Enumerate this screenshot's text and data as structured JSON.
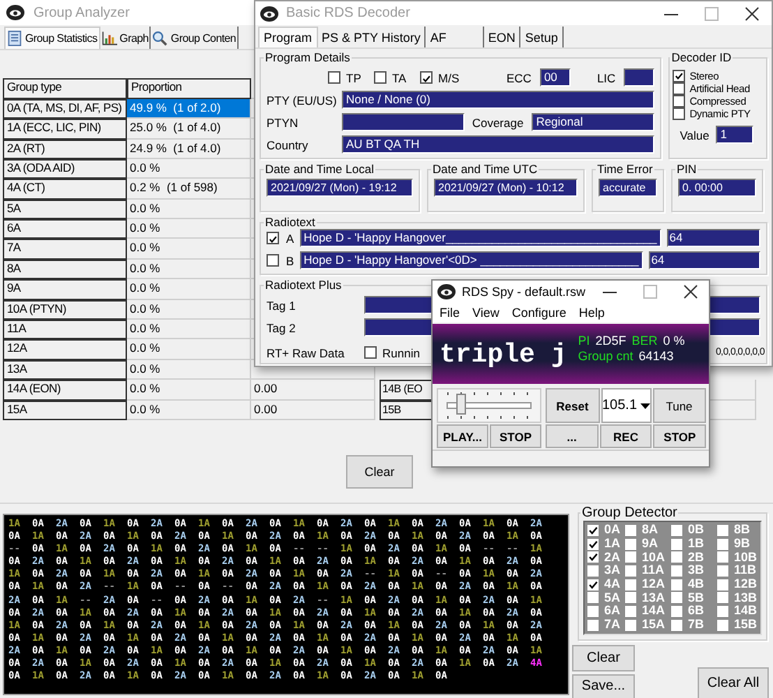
{
  "analyzer": {
    "title": "Group Analyzer",
    "tabs": [
      {
        "label": "Group Statistics",
        "selected": true
      },
      {
        "label": "Graph",
        "selected": false
      },
      {
        "label": "Group Conten",
        "selected": false
      }
    ],
    "table": {
      "columns": [
        "Group type",
        "Proportion"
      ],
      "rows": [
        {
          "group_type": "0A (TA, MS, DI, AF, PS)",
          "proportion": "49.9 %  (1 of 2.0)",
          "selected": true
        },
        {
          "group_type": "1A (ECC, LIC, PIN)",
          "proportion": "25.0 %  (1 of 4.0)",
          "selected": false
        },
        {
          "group_type": "2A (RT)",
          "proportion": "24.9 %  (1 of 4.0)",
          "selected": false
        },
        {
          "group_type": "3A (ODA AID)",
          "proportion": "0.0 %",
          "selected": false
        },
        {
          "group_type": "4A (CT)",
          "proportion": "0.2 %  (1 of 598)",
          "selected": false
        },
        {
          "group_type": "5A",
          "proportion": "0.0 %",
          "selected": false
        },
        {
          "group_type": "6A",
          "proportion": "0.0 %",
          "selected": false
        },
        {
          "group_type": "7A",
          "proportion": "0.0 %",
          "selected": false
        },
        {
          "group_type": "8A",
          "proportion": "0.0 %",
          "selected": false
        },
        {
          "group_type": "9A",
          "proportion": "0.0 %",
          "selected": false
        },
        {
          "group_type": "10A (PTYN)",
          "proportion": "0.0 %",
          "selected": false
        },
        {
          "group_type": "11A",
          "proportion": "0.0 %",
          "selected": false
        },
        {
          "group_type": "12A",
          "proportion": "0.0 %",
          "selected": false
        },
        {
          "group_type": "13A",
          "proportion": "0.0 %",
          "selected": false
        },
        {
          "group_type": "14A (EON)",
          "proportion": "0.0 %",
          "column_3": "0.00",
          "selected": false
        },
        {
          "group_type": "15A",
          "proportion": "0.0 %",
          "column_3": "0.00",
          "selected": false
        }
      ]
    },
    "right_table": {
      "rows": [
        {
          "group_type": "14B (EO"
        },
        {
          "group_type": "15B"
        }
      ]
    },
    "clear_button": "Clear"
  },
  "log": {
    "rows": [
      [
        {
          "group": "1A",
          "color": "#a0a030"
        },
        {
          "group": "0A",
          "color": "#ffffff"
        },
        {
          "group": "2A",
          "color": "#a8cff0"
        },
        {
          "group": "0A",
          "color": "#ffffff"
        },
        {
          "group": "1A",
          "color": "#a0a030"
        },
        {
          "group": "0A",
          "color": "#ffffff"
        },
        {
          "group": "2A",
          "color": "#a8cff0"
        },
        {
          "group": "0A",
          "color": "#ffffff"
        },
        {
          "group": "1A",
          "color": "#a0a030"
        },
        {
          "group": "0A",
          "color": "#ffffff"
        },
        {
          "group": "2A",
          "color": "#a8cff0"
        },
        {
          "group": "0A",
          "color": "#ffffff"
        },
        {
          "group": "1A",
          "color": "#a0a030"
        },
        {
          "group": "0A",
          "color": "#ffffff"
        },
        {
          "group": "2A",
          "color": "#a8cff0"
        },
        {
          "group": "0A",
          "color": "#ffffff"
        },
        {
          "group": "1A",
          "color": "#a0a030"
        },
        {
          "group": "0A",
          "color": "#ffffff"
        },
        {
          "group": "2A",
          "color": "#a8cff0"
        },
        {
          "group": "0A",
          "color": "#ffffff"
        },
        {
          "group": "1A",
          "color": "#a0a030"
        },
        {
          "group": "0A",
          "color": "#ffffff"
        },
        {
          "group": "2A",
          "color": "#a8cff0"
        }
      ],
      [
        {
          "group": "0A",
          "color": "#ffffff"
        },
        {
          "group": "1A",
          "color": "#a0a030"
        },
        {
          "group": "0A",
          "color": "#ffffff"
        },
        {
          "group": "2A",
          "color": "#a8cff0"
        },
        {
          "group": "0A",
          "color": "#ffffff"
        },
        {
          "group": "1A",
          "color": "#a0a030"
        },
        {
          "group": "0A",
          "color": "#ffffff"
        },
        {
          "group": "2A",
          "color": "#a8cff0"
        },
        {
          "group": "0A",
          "color": "#ffffff"
        },
        {
          "group": "1A",
          "color": "#a0a030"
        },
        {
          "group": "0A",
          "color": "#ffffff"
        },
        {
          "group": "2A",
          "color": "#a8cff0"
        },
        {
          "group": "0A",
          "color": "#ffffff"
        },
        {
          "group": "1A",
          "color": "#a0a030"
        },
        {
          "group": "0A",
          "color": "#ffffff"
        },
        {
          "group": "2A",
          "color": "#a8cff0"
        },
        {
          "group": "0A",
          "color": "#ffffff"
        },
        {
          "group": "1A",
          "color": "#a0a030"
        },
        {
          "group": "0A",
          "color": "#ffffff"
        },
        {
          "group": "2A",
          "color": "#a8cff0"
        },
        {
          "group": "0A",
          "color": "#ffffff"
        },
        {
          "group": "1A",
          "color": "#a0a030"
        },
        {
          "group": "0A",
          "color": "#ffffff"
        }
      ],
      [
        {
          "group": "--",
          "color": "#8c8c8c"
        },
        {
          "group": "0A",
          "color": "#ffffff"
        },
        {
          "group": "1A",
          "color": "#a0a030"
        },
        {
          "group": "0A",
          "color": "#ffffff"
        },
        {
          "group": "2A",
          "color": "#a8cff0"
        },
        {
          "group": "0A",
          "color": "#ffffff"
        },
        {
          "group": "1A",
          "color": "#a0a030"
        },
        {
          "group": "0A",
          "color": "#ffffff"
        },
        {
          "group": "2A",
          "color": "#a8cff0"
        },
        {
          "group": "0A",
          "color": "#ffffff"
        },
        {
          "group": "1A",
          "color": "#a0a030"
        },
        {
          "group": "0A",
          "color": "#ffffff"
        },
        {
          "group": "--",
          "color": "#8c8c8c"
        },
        {
          "group": "--",
          "color": "#8c8c8c"
        },
        {
          "group": "1A",
          "color": "#a0a030"
        },
        {
          "group": "0A",
          "color": "#ffffff"
        },
        {
          "group": "2A",
          "color": "#a8cff0"
        },
        {
          "group": "0A",
          "color": "#ffffff"
        },
        {
          "group": "1A",
          "color": "#a0a030"
        },
        {
          "group": "0A",
          "color": "#ffffff"
        },
        {
          "group": "--",
          "color": "#8c8c8c"
        },
        {
          "group": "--",
          "color": "#8c8c8c"
        },
        {
          "group": "1A",
          "color": "#a0a030"
        }
      ],
      [
        {
          "group": "0A",
          "color": "#ffffff"
        },
        {
          "group": "2A",
          "color": "#a8cff0"
        },
        {
          "group": "0A",
          "color": "#ffffff"
        },
        {
          "group": "1A",
          "color": "#a0a030"
        },
        {
          "group": "0A",
          "color": "#ffffff"
        },
        {
          "group": "2A",
          "color": "#a8cff0"
        },
        {
          "group": "0A",
          "color": "#ffffff"
        },
        {
          "group": "1A",
          "color": "#a0a030"
        },
        {
          "group": "0A",
          "color": "#ffffff"
        },
        {
          "group": "2A",
          "color": "#a8cff0"
        },
        {
          "group": "0A",
          "color": "#ffffff"
        },
        {
          "group": "1A",
          "color": "#a0a030"
        },
        {
          "group": "0A",
          "color": "#ffffff"
        },
        {
          "group": "2A",
          "color": "#a8cff0"
        },
        {
          "group": "0A",
          "color": "#ffffff"
        },
        {
          "group": "1A",
          "color": "#a0a030"
        },
        {
          "group": "0A",
          "color": "#ffffff"
        },
        {
          "group": "2A",
          "color": "#a8cff0"
        },
        {
          "group": "0A",
          "color": "#ffffff"
        },
        {
          "group": "1A",
          "color": "#a0a030"
        },
        {
          "group": "0A",
          "color": "#ffffff"
        },
        {
          "group": "2A",
          "color": "#a8cff0"
        },
        {
          "group": "0A",
          "color": "#ffffff"
        }
      ],
      [
        {
          "group": "1A",
          "color": "#a0a030"
        },
        {
          "group": "0A",
          "color": "#ffffff"
        },
        {
          "group": "2A",
          "color": "#a8cff0"
        },
        {
          "group": "0A",
          "color": "#ffffff"
        },
        {
          "group": "1A",
          "color": "#a0a030"
        },
        {
          "group": "0A",
          "color": "#ffffff"
        },
        {
          "group": "2A",
          "color": "#a8cff0"
        },
        {
          "group": "0A",
          "color": "#ffffff"
        },
        {
          "group": "1A",
          "color": "#a0a030"
        },
        {
          "group": "0A",
          "color": "#ffffff"
        },
        {
          "group": "2A",
          "color": "#a8cff0"
        },
        {
          "group": "0A",
          "color": "#ffffff"
        },
        {
          "group": "1A",
          "color": "#a0a030"
        },
        {
          "group": "0A",
          "color": "#ffffff"
        },
        {
          "group": "2A",
          "color": "#a8cff0"
        },
        {
          "group": "--",
          "color": "#8c8c8c"
        },
        {
          "group": "1A",
          "color": "#a0a030"
        },
        {
          "group": "0A",
          "color": "#ffffff"
        },
        {
          "group": "--",
          "color": "#8c8c8c"
        },
        {
          "group": "0A",
          "color": "#ffffff"
        },
        {
          "group": "1A",
          "color": "#a0a030"
        },
        {
          "group": "0A",
          "color": "#ffffff"
        },
        {
          "group": "2A",
          "color": "#a8cff0"
        }
      ],
      [
        {
          "group": "0A",
          "color": "#ffffff"
        },
        {
          "group": "1A",
          "color": "#a0a030"
        },
        {
          "group": "0A",
          "color": "#ffffff"
        },
        {
          "group": "2A",
          "color": "#a8cff0"
        },
        {
          "group": "--",
          "color": "#8c8c8c"
        },
        {
          "group": "1A",
          "color": "#a0a030"
        },
        {
          "group": "0A",
          "color": "#ffffff"
        },
        {
          "group": "--",
          "color": "#8c8c8c"
        },
        {
          "group": "0A",
          "color": "#ffffff"
        },
        {
          "group": "--",
          "color": "#8c8c8c"
        },
        {
          "group": "0A",
          "color": "#ffffff"
        },
        {
          "group": "2A",
          "color": "#a8cff0"
        },
        {
          "group": "0A",
          "color": "#ffffff"
        },
        {
          "group": "1A",
          "color": "#a0a030"
        },
        {
          "group": "0A",
          "color": "#ffffff"
        },
        {
          "group": "2A",
          "color": "#a8cff0"
        },
        {
          "group": "0A",
          "color": "#ffffff"
        },
        {
          "group": "1A",
          "color": "#a0a030"
        },
        {
          "group": "0A",
          "color": "#ffffff"
        },
        {
          "group": "2A",
          "color": "#a8cff0"
        },
        {
          "group": "0A",
          "color": "#ffffff"
        },
        {
          "group": "1A",
          "color": "#a0a030"
        },
        {
          "group": "0A",
          "color": "#ffffff"
        }
      ],
      [
        {
          "group": "2A",
          "color": "#a8cff0"
        },
        {
          "group": "0A",
          "color": "#ffffff"
        },
        {
          "group": "1A",
          "color": "#a0a030"
        },
        {
          "group": "--",
          "color": "#8c8c8c"
        },
        {
          "group": "2A",
          "color": "#a8cff0"
        },
        {
          "group": "0A",
          "color": "#ffffff"
        },
        {
          "group": "--",
          "color": "#8c8c8c"
        },
        {
          "group": "0A",
          "color": "#ffffff"
        },
        {
          "group": "2A",
          "color": "#a8cff0"
        },
        {
          "group": "0A",
          "color": "#ffffff"
        },
        {
          "group": "1A",
          "color": "#a0a030"
        },
        {
          "group": "0A",
          "color": "#ffffff"
        },
        {
          "group": "2A",
          "color": "#a8cff0"
        },
        {
          "group": "--",
          "color": "#8c8c8c"
        },
        {
          "group": "1A",
          "color": "#a0a030"
        },
        {
          "group": "0A",
          "color": "#ffffff"
        },
        {
          "group": "2A",
          "color": "#a8cff0"
        },
        {
          "group": "0A",
          "color": "#ffffff"
        },
        {
          "group": "1A",
          "color": "#a0a030"
        },
        {
          "group": "0A",
          "color": "#ffffff"
        },
        {
          "group": "2A",
          "color": "#a8cff0"
        },
        {
          "group": "0A",
          "color": "#ffffff"
        },
        {
          "group": "1A",
          "color": "#a0a030"
        }
      ],
      [
        {
          "group": "0A",
          "color": "#ffffff"
        },
        {
          "group": "2A",
          "color": "#a8cff0"
        },
        {
          "group": "0A",
          "color": "#ffffff"
        },
        {
          "group": "1A",
          "color": "#a0a030"
        },
        {
          "group": "0A",
          "color": "#ffffff"
        },
        {
          "group": "2A",
          "color": "#a8cff0"
        },
        {
          "group": "0A",
          "color": "#ffffff"
        },
        {
          "group": "1A",
          "color": "#a0a030"
        },
        {
          "group": "0A",
          "color": "#ffffff"
        },
        {
          "group": "2A",
          "color": "#a8cff0"
        },
        {
          "group": "0A",
          "color": "#ffffff"
        },
        {
          "group": "1A",
          "color": "#a0a030"
        },
        {
          "group": "0A",
          "color": "#ffffff"
        },
        {
          "group": "2A",
          "color": "#a8cff0"
        },
        {
          "group": "0A",
          "color": "#ffffff"
        },
        {
          "group": "1A",
          "color": "#a0a030"
        },
        {
          "group": "0A",
          "color": "#ffffff"
        },
        {
          "group": "2A",
          "color": "#a8cff0"
        },
        {
          "group": "0A",
          "color": "#ffffff"
        },
        {
          "group": "1A",
          "color": "#a0a030"
        },
        {
          "group": "0A",
          "color": "#ffffff"
        },
        {
          "group": "2A",
          "color": "#a8cff0"
        },
        {
          "group": "0A",
          "color": "#ffffff"
        }
      ],
      [
        {
          "group": "1A",
          "color": "#a0a030"
        },
        {
          "group": "0A",
          "color": "#ffffff"
        },
        {
          "group": "2A",
          "color": "#a8cff0"
        },
        {
          "group": "0A",
          "color": "#ffffff"
        },
        {
          "group": "1A",
          "color": "#a0a030"
        },
        {
          "group": "0A",
          "color": "#ffffff"
        },
        {
          "group": "2A",
          "color": "#a8cff0"
        },
        {
          "group": "0A",
          "color": "#ffffff"
        },
        {
          "group": "1A",
          "color": "#a0a030"
        },
        {
          "group": "0A",
          "color": "#ffffff"
        },
        {
          "group": "2A",
          "color": "#a8cff0"
        },
        {
          "group": "0A",
          "color": "#ffffff"
        },
        {
          "group": "1A",
          "color": "#a0a030"
        },
        {
          "group": "0A",
          "color": "#ffffff"
        },
        {
          "group": "2A",
          "color": "#a8cff0"
        },
        {
          "group": "0A",
          "color": "#ffffff"
        },
        {
          "group": "1A",
          "color": "#a0a030"
        },
        {
          "group": "0A",
          "color": "#ffffff"
        },
        {
          "group": "2A",
          "color": "#a8cff0"
        },
        {
          "group": "0A",
          "color": "#ffffff"
        },
        {
          "group": "1A",
          "color": "#a0a030"
        },
        {
          "group": "0A",
          "color": "#ffffff"
        },
        {
          "group": "2A",
          "color": "#a8cff0"
        }
      ],
      [
        {
          "group": "0A",
          "color": "#ffffff"
        },
        {
          "group": "1A",
          "color": "#a0a030"
        },
        {
          "group": "0A",
          "color": "#ffffff"
        },
        {
          "group": "2A",
          "color": "#a8cff0"
        },
        {
          "group": "0A",
          "color": "#ffffff"
        },
        {
          "group": "1A",
          "color": "#a0a030"
        },
        {
          "group": "0A",
          "color": "#ffffff"
        },
        {
          "group": "2A",
          "color": "#a8cff0"
        },
        {
          "group": "0A",
          "color": "#ffffff"
        },
        {
          "group": "1A",
          "color": "#a0a030"
        },
        {
          "group": "0A",
          "color": "#ffffff"
        },
        {
          "group": "2A",
          "color": "#a8cff0"
        },
        {
          "group": "0A",
          "color": "#ffffff"
        },
        {
          "group": "1A",
          "color": "#a0a030"
        },
        {
          "group": "0A",
          "color": "#ffffff"
        },
        {
          "group": "2A",
          "color": "#a8cff0"
        },
        {
          "group": "0A",
          "color": "#ffffff"
        },
        {
          "group": "1A",
          "color": "#a0a030"
        },
        {
          "group": "0A",
          "color": "#ffffff"
        },
        {
          "group": "2A",
          "color": "#a8cff0"
        },
        {
          "group": "0A",
          "color": "#ffffff"
        },
        {
          "group": "1A",
          "color": "#a0a030"
        },
        {
          "group": "0A",
          "color": "#ffffff"
        }
      ],
      [
        {
          "group": "2A",
          "color": "#a8cff0"
        },
        {
          "group": "0A",
          "color": "#ffffff"
        },
        {
          "group": "1A",
          "color": "#a0a030"
        },
        {
          "group": "0A",
          "color": "#ffffff"
        },
        {
          "group": "2A",
          "color": "#a8cff0"
        },
        {
          "group": "0A",
          "color": "#ffffff"
        },
        {
          "group": "1A",
          "color": "#a0a030"
        },
        {
          "group": "0A",
          "color": "#ffffff"
        },
        {
          "group": "2A",
          "color": "#a8cff0"
        },
        {
          "group": "0A",
          "color": "#ffffff"
        },
        {
          "group": "1A",
          "color": "#a0a030"
        },
        {
          "group": "0A",
          "color": "#ffffff"
        },
        {
          "group": "2A",
          "color": "#a8cff0"
        },
        {
          "group": "0A",
          "color": "#ffffff"
        },
        {
          "group": "1A",
          "color": "#a0a030"
        },
        {
          "group": "0A",
          "color": "#ffffff"
        },
        {
          "group": "2A",
          "color": "#a8cff0"
        },
        {
          "group": "0A",
          "color": "#ffffff"
        },
        {
          "group": "1A",
          "color": "#a0a030"
        },
        {
          "group": "0A",
          "color": "#ffffff"
        },
        {
          "group": "2A",
          "color": "#a8cff0"
        },
        {
          "group": "0A",
          "color": "#ffffff"
        },
        {
          "group": "1A",
          "color": "#a0a030"
        }
      ],
      [
        {
          "group": "0A",
          "color": "#ffffff"
        },
        {
          "group": "2A",
          "color": "#a8cff0"
        },
        {
          "group": "0A",
          "color": "#ffffff"
        },
        {
          "group": "1A",
          "color": "#a0a030"
        },
        {
          "group": "0A",
          "color": "#ffffff"
        },
        {
          "group": "2A",
          "color": "#a8cff0"
        },
        {
          "group": "0A",
          "color": "#ffffff"
        },
        {
          "group": "1A",
          "color": "#a0a030"
        },
        {
          "group": "0A",
          "color": "#ffffff"
        },
        {
          "group": "2A",
          "color": "#a8cff0"
        },
        {
          "group": "0A",
          "color": "#ffffff"
        },
        {
          "group": "1A",
          "color": "#a0a030"
        },
        {
          "group": "0A",
          "color": "#ffffff"
        },
        {
          "group": "2A",
          "color": "#a8cff0"
        },
        {
          "group": "0A",
          "color": "#ffffff"
        },
        {
          "group": "1A",
          "color": "#a0a030"
        },
        {
          "group": "0A",
          "color": "#ffffff"
        },
        {
          "group": "2A",
          "color": "#a8cff0"
        },
        {
          "group": "0A",
          "color": "#ffffff"
        },
        {
          "group": "1A",
          "color": "#a0a030"
        },
        {
          "group": "0A",
          "color": "#ffffff"
        },
        {
          "group": "2A",
          "color": "#a8cff0"
        },
        {
          "group": "4A",
          "color": "#ff30ff"
        }
      ],
      [
        {
          "group": "0A",
          "color": "#ffffff"
        },
        {
          "group": "1A",
          "color": "#a0a030"
        },
        {
          "group": "0A",
          "color": "#ffffff"
        },
        {
          "group": "2A",
          "color": "#a8cff0"
        },
        {
          "group": "0A",
          "color": "#ffffff"
        },
        {
          "group": "1A",
          "color": "#a0a030"
        },
        {
          "group": "0A",
          "color": "#ffffff"
        },
        {
          "group": "2A",
          "color": "#a8cff0"
        },
        {
          "group": "0A",
          "color": "#ffffff"
        },
        {
          "group": "1A",
          "color": "#a0a030"
        },
        {
          "group": "0A",
          "color": "#ffffff"
        },
        {
          "group": "2A",
          "color": "#a8cff0"
        },
        {
          "group": "0A",
          "color": "#ffffff"
        },
        {
          "group": "1A",
          "color": "#a0a030"
        },
        {
          "group": "0A",
          "color": "#ffffff"
        },
        {
          "group": "2A",
          "color": "#a8cff0"
        },
        {
          "group": "0A",
          "color": "#ffffff"
        },
        {
          "group": "1A",
          "color": "#a0a030"
        },
        {
          "group": "0A",
          "color": "#ffffff"
        }
      ]
    ]
  },
  "detector": {
    "title": "Group Detector",
    "items": [
      {
        "label": "0A",
        "checked": true
      },
      {
        "label": "8A",
        "checked": false
      },
      {
        "label": "0B",
        "checked": false
      },
      {
        "label": "8B",
        "checked": false
      },
      {
        "label": "1A",
        "checked": true
      },
      {
        "label": "9A",
        "checked": false
      },
      {
        "label": "1B",
        "checked": false
      },
      {
        "label": "9B",
        "checked": false
      },
      {
        "label": "2A",
        "checked": true
      },
      {
        "label": "10A",
        "checked": false
      },
      {
        "label": "2B",
        "checked": false
      },
      {
        "label": "10B",
        "checked": false
      },
      {
        "label": "3A",
        "checked": false
      },
      {
        "label": "11A",
        "checked": false
      },
      {
        "label": "3B",
        "checked": false
      },
      {
        "label": "11B",
        "checked": false
      },
      {
        "label": "4A",
        "checked": true
      },
      {
        "label": "12A",
        "checked": false
      },
      {
        "label": "4B",
        "checked": false
      },
      {
        "label": "12B",
        "checked": false
      },
      {
        "label": "5A",
        "checked": false
      },
      {
        "label": "13A",
        "checked": false
      },
      {
        "label": "5B",
        "checked": false
      },
      {
        "label": "13B",
        "checked": false
      },
      {
        "label": "6A",
        "checked": false
      },
      {
        "label": "14A",
        "checked": false
      },
      {
        "label": "6B",
        "checked": false
      },
      {
        "label": "14B",
        "checked": false
      },
      {
        "label": "7A",
        "checked": false
      },
      {
        "label": "15A",
        "checked": false
      },
      {
        "label": "7B",
        "checked": false
      },
      {
        "label": "15B",
        "checked": false
      }
    ],
    "buttons": [
      "Clear",
      "Save...",
      "Clear All"
    ]
  },
  "decoder": {
    "title": "Basic RDS Decoder",
    "tabs": [
      {
        "label": "Program",
        "selected": true
      },
      {
        "label": "PS & PTY History",
        "selected": false
      },
      {
        "label": "AF",
        "selected": false
      },
      {
        "label": "EON",
        "selected": false
      },
      {
        "label": "Setup",
        "selected": false
      }
    ],
    "program_details": {
      "title": "Program Details",
      "flags": [
        {
          "label": "TP",
          "checked": false
        },
        {
          "label": "TA",
          "checked": false
        },
        {
          "label": "M/S",
          "checked": true
        }
      ],
      "ecc_label": "ECC",
      "ecc": "00",
      "lic_label": "LIC",
      "pty_label": "PTY (EU/US)",
      "pty": "None / None (0)",
      "ptyn_label": "PTYN",
      "coverage_label": "Coverage",
      "coverage": "Regional",
      "country_label": "Country",
      "country": "AU BT QA TH"
    },
    "decoder_id": {
      "title": "Decoder ID",
      "flags": [
        {
          "label": "Stereo",
          "checked": true
        },
        {
          "label": "Artificial Head",
          "checked": false
        },
        {
          "label": "Compressed",
          "checked": false
        },
        {
          "label": "Dynamic PTY",
          "checked": false
        }
      ],
      "value_label": "Value",
      "value": "1"
    },
    "times": [
      {
        "title": "Date and Time Local",
        "value": "2021/09/27 (Mon) - 19:12"
      },
      {
        "title": "Date and Time UTC",
        "value": "2021/09/27 (Mon) - 10:12"
      },
      {
        "title": "Time Error",
        "value": "accurate"
      },
      {
        "title": "PIN",
        "value": "0. 00:00"
      }
    ],
    "radiotext": {
      "title": "Radiotext",
      "lines": [
        {
          "label": "A",
          "checked": true,
          "text": "Hope D - 'Happy Hangover________________________________",
          "count": "64"
        },
        {
          "label": "B",
          "checked": false,
          "text": "Hope D - 'Happy Hangover'<0D> ________________________",
          "count": "64"
        }
      ]
    },
    "rt_plus": {
      "title": "Radiotext Plus",
      "tag1_label": "Tag 1",
      "tag2_label": "Tag 2",
      "raw_label": "RT+ Raw Data",
      "running": {
        "label": "Runnin",
        "checked": false
      },
      "raw": "0,0,0,0,0,0,0"
    }
  },
  "spy": {
    "title": "RDS Spy - default.rsw",
    "menu": [
      "File",
      "View",
      "Configure",
      "Help"
    ],
    "ps": "triple j",
    "pi_label": "PI",
    "pi": "2D5F",
    "ber_label": "BER",
    "ber": "0 %",
    "group_cnt_label": "Group cnt",
    "group_cnt": "64143",
    "slider": {
      "level": 0.15
    },
    "reset": "Reset",
    "frequency": "105.1",
    "tune": "Tune",
    "buttons": [
      "PLAY...",
      "STOP",
      "...",
      "REC",
      "STOP"
    ]
  }
}
